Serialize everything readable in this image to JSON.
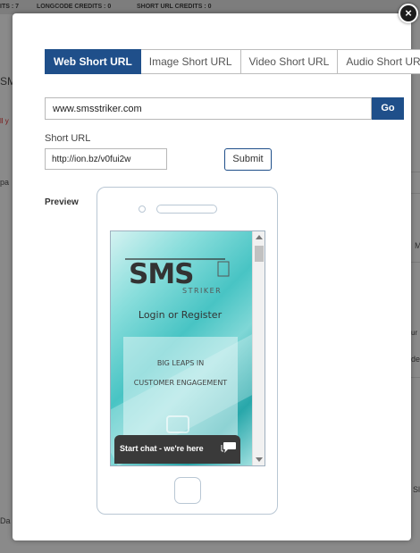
{
  "background": {
    "topbar": {
      "credits_a": "ITS : 7",
      "longcode": "LONGCODE CREDITS : 0",
      "shorturl": "SHORT URL CREDITS : 0"
    },
    "fragments": [
      "SM",
      "ll y",
      "pa",
      "M",
      "ur",
      "de",
      "Sl",
      "Da"
    ]
  },
  "modal": {
    "close_label": "×",
    "tabs": [
      "Web Short URL",
      "Image Short URL",
      "Video Short URL",
      "Audio Short URL"
    ],
    "active_tab": "Web Short URL",
    "url_input_value": "www.smsstriker.com",
    "go_label": "Go",
    "short_url_label": "Short URL",
    "short_url_value": "http://ion.bz/v0fui2w",
    "submit_label": "Submit",
    "preview_label": "Preview"
  },
  "phone_preview": {
    "logo_text": "SMS",
    "logo_subtext": "STRIKER",
    "login_text": "Login or Register",
    "promo_line1": "BIG LEAPS IN",
    "promo_line2": "CUSTOMER ENGAGEMENT",
    "chat_label": "Start chat - we're here"
  },
  "colors": {
    "accent": "#1f4f8a",
    "phone_border": "#b9c7d4",
    "chat_bar": "#3a3a3a",
    "overlay": "#8a8a8a"
  },
  "icons": {
    "close": "close-icon",
    "chat": "chat-bubble-icon",
    "camera": "camera-icon",
    "home": "home-button-icon"
  }
}
